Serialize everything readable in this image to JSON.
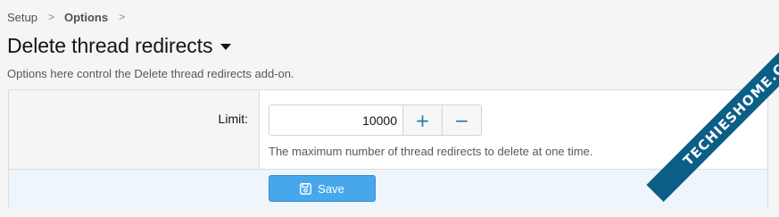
{
  "breadcrumb": {
    "items": [
      "Setup",
      "Options"
    ],
    "separator": ">"
  },
  "header": {
    "title": "Delete thread redirects",
    "description": "Options here control the Delete thread redirects add-on."
  },
  "options": {
    "limit": {
      "label": "Limit:",
      "value": "10000",
      "increment_symbol": "+",
      "decrement_symbol": "−",
      "explain": "The maximum number of thread redirects to delete at one time."
    }
  },
  "actions": {
    "save_label": "Save",
    "save_icon": "floppy-disk-icon"
  },
  "watermark": {
    "text": "TECHIESHOME.COM"
  },
  "colors": {
    "accent": "#47a7eb",
    "stepper_icon": "#2577b1",
    "submit_row_bg": "#eef5fb",
    "watermark_bg": "#0b5f86"
  }
}
